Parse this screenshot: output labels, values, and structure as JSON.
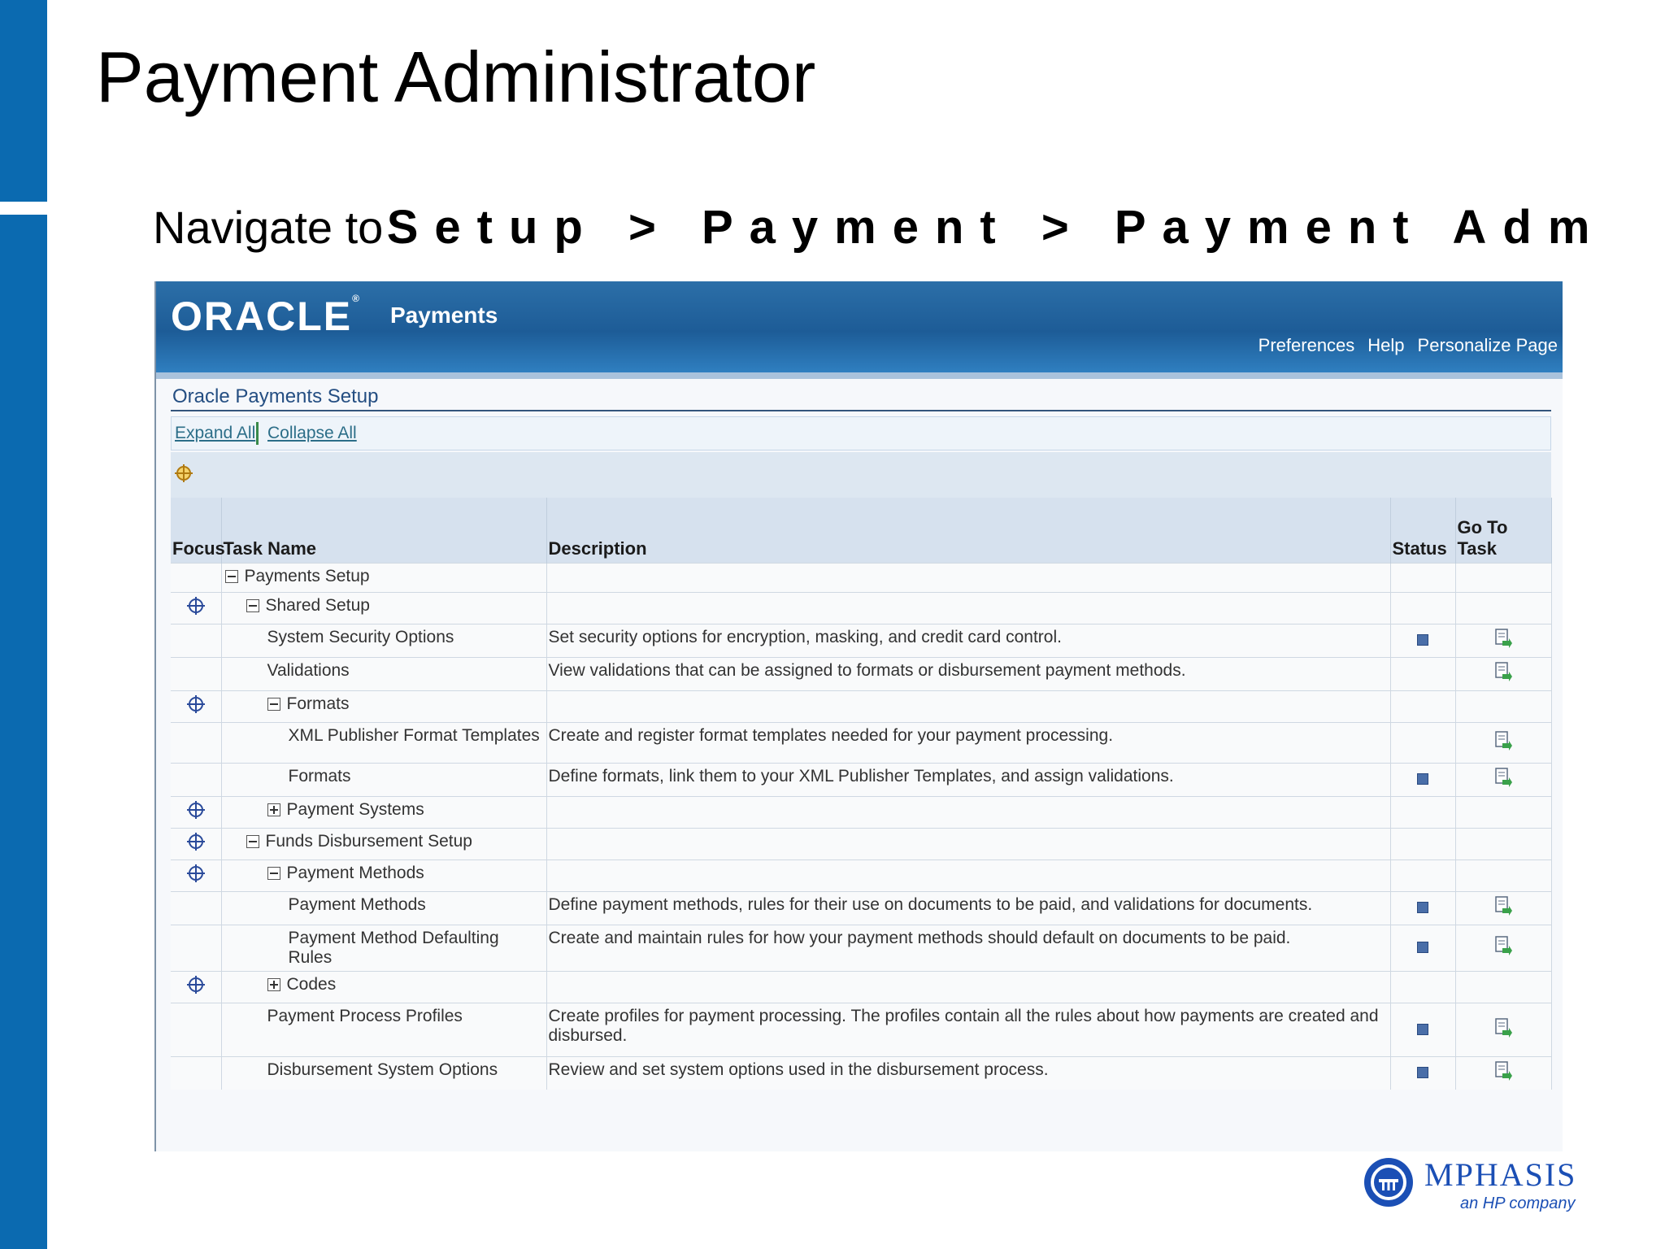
{
  "slide": {
    "title": "Payment Administrator",
    "nav_lead": "Navigate to",
    "nav_path": "Setup > Payment > Payment Administrator"
  },
  "app": {
    "logo": "ORACLE",
    "name": "Payments",
    "global_links": [
      "Preferences",
      "Help",
      "Personalize Page"
    ]
  },
  "section": {
    "title": "Oracle Payments Setup",
    "expand_all": "Expand All",
    "collapse_all": "Collapse All"
  },
  "table": {
    "headers": {
      "focus": "Focus",
      "task_name": "Task Name",
      "description": "Description",
      "status": "Status",
      "go_to_task": "Go To Task"
    },
    "rows": [
      {
        "focus": false,
        "level": 0,
        "toggle": "minus",
        "name": "Payments Setup",
        "description": "",
        "status": false,
        "goto": false
      },
      {
        "focus": true,
        "level": 1,
        "toggle": "minus",
        "name": "Shared Setup",
        "description": "",
        "status": false,
        "goto": false
      },
      {
        "focus": false,
        "level": 2,
        "toggle": "",
        "name": "System Security Options",
        "description": "Set security options for encryption, masking, and credit card control.",
        "status": true,
        "goto": true
      },
      {
        "focus": false,
        "level": 2,
        "toggle": "",
        "name": "Validations",
        "description": "View validations that can be assigned to formats or disbursement payment methods.",
        "status": false,
        "goto": true
      },
      {
        "focus": true,
        "level": 2,
        "toggle": "minus",
        "name": "Formats",
        "description": "",
        "status": false,
        "goto": false
      },
      {
        "focus": false,
        "level": 3,
        "toggle": "",
        "name": "XML Publisher Format Templates",
        "description": "Create and register format templates needed for your payment processing.",
        "status": false,
        "goto": true
      },
      {
        "focus": false,
        "level": 3,
        "toggle": "",
        "name": "Formats",
        "description": "Define formats, link them to your XML Publisher Templates, and assign validations.",
        "status": true,
        "goto": true
      },
      {
        "focus": true,
        "level": 2,
        "toggle": "plus",
        "name": "Payment Systems",
        "description": "",
        "status": false,
        "goto": false
      },
      {
        "focus": true,
        "level": 1,
        "toggle": "minus",
        "name": "Funds Disbursement Setup",
        "description": "",
        "status": false,
        "goto": false
      },
      {
        "focus": true,
        "level": 2,
        "toggle": "minus",
        "name": "Payment Methods",
        "description": "",
        "status": false,
        "goto": false
      },
      {
        "focus": false,
        "level": 3,
        "toggle": "",
        "name": "Payment Methods",
        "description": "Define payment methods, rules for their use on documents to be paid, and validations for documents.",
        "status": true,
        "goto": true
      },
      {
        "focus": false,
        "level": 3,
        "toggle": "",
        "name": "Payment Method Defaulting Rules",
        "description": "Create and maintain rules for how your payment methods should default on documents to be paid.",
        "status": true,
        "goto": true
      },
      {
        "focus": true,
        "level": 2,
        "toggle": "plus",
        "name": "Codes",
        "description": "",
        "status": false,
        "goto": false
      },
      {
        "focus": false,
        "level": 2,
        "toggle": "",
        "name": "Payment Process Profiles",
        "description": "Create profiles for payment processing. The profiles contain all the rules about how payments are created and disbursed.",
        "status": true,
        "goto": true
      },
      {
        "focus": false,
        "level": 2,
        "toggle": "",
        "name": "Disbursement System Options",
        "description": "Review and set system options used in the disbursement process.",
        "status": true,
        "goto": true
      }
    ]
  },
  "brand": {
    "name": "MPHASIS",
    "tagline": "an HP company"
  },
  "colors": {
    "slide_bar": "#0b6ab0",
    "header": "#1d5c97",
    "link": "#2c6e88"
  }
}
